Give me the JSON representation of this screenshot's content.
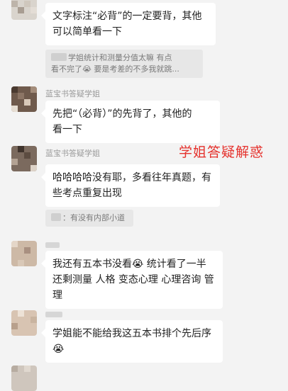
{
  "messages": {
    "m1": {
      "lines": [
        "文字标注“必背”的一定要背，其他",
        "可以简单看一下"
      ]
    },
    "q1": {
      "lines": [
        "学姐统计和测量分值太嘛 有点",
        "看不完了😭 要是考差的不多我就跳..."
      ]
    },
    "m2": {
      "sender": "蓝宝书答疑学姐",
      "lines": [
        "先把“（必背）”的先背了，其他的",
        "看一下"
      ]
    },
    "m3": {
      "sender": "蓝宝书答疑学姐",
      "lines": [
        "哈哈哈哈没有耶，多看往年真题，有",
        "些考点重复出现"
      ]
    },
    "q2": {
      "text": "：有没有内部小道"
    },
    "m4": {
      "lines": [
        "我还有五本书没看😭 统计看了一半",
        "还剩测量 人格 变态心理 心理咨询 管",
        "理"
      ]
    },
    "m5": {
      "lines": [
        "学姐能不能给我这五本书排个先后序",
        "😭"
      ]
    }
  },
  "overlay": {
    "text": "学姐答疑解惑",
    "color": "#e5322d"
  }
}
